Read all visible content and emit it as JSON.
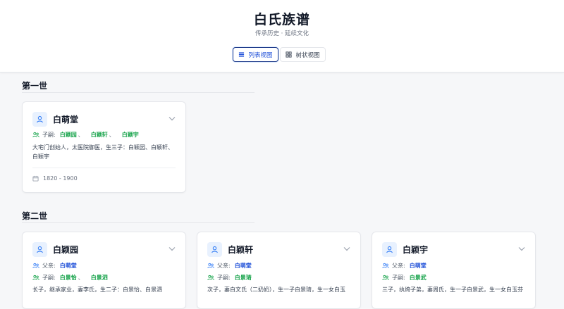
{
  "header": {
    "title": "白氏族谱",
    "subtitle": "传承历史 · 延续文化",
    "list_view_label": "列表视图",
    "tree_view_label": "树状视图"
  },
  "labels": {
    "father": "父亲:",
    "children": "子嗣:"
  },
  "generations": [
    {
      "title": "第一世",
      "members": [
        {
          "name": "白萌堂",
          "children": [
            "白颖园",
            "白颖轩",
            "白颖宇"
          ],
          "desc": "大宅门创始人，太医院御医，生三子：白颖园、白颖轩、白颖宇",
          "years": "1820 - 1900"
        }
      ]
    },
    {
      "title": "第二世",
      "members": [
        {
          "name": "白颖园",
          "father": "白萌堂",
          "children": [
            "白景怡",
            "白景泗"
          ],
          "desc": "长子，继承家业，妻李氏，生二子：白景怡、白景泗"
        },
        {
          "name": "白颖轩",
          "father": "白萌堂",
          "children": [
            "白景琦"
          ],
          "desc": "次子，妻白文氏（二奶奶），生一子白景琦，生一女白玉"
        },
        {
          "name": "白颖宇",
          "father": "白萌堂",
          "children": [
            "白景武"
          ],
          "desc": "三子，纨绔子弟，妻周氏，生一子白景武，生一女白玉芬"
        }
      ]
    }
  ],
  "colors": {
    "accent_blue": "#1d4ed8",
    "accent_green": "#16a34a",
    "avatar_bg": "#e8f1fe"
  }
}
